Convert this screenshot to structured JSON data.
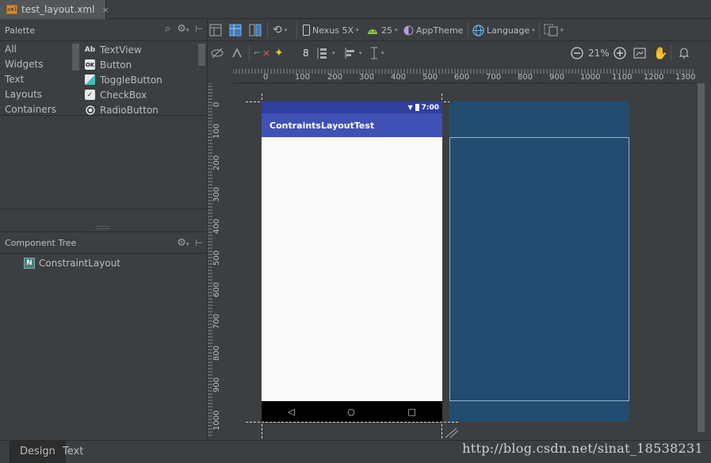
{
  "file_tab": {
    "name": "test_layout.xml",
    "close": "×",
    "icon_label": "xml"
  },
  "palette": {
    "title": "Palette",
    "categories": [
      "All",
      "Widgets",
      "Text",
      "Layouts",
      "Containers"
    ],
    "items": [
      {
        "label": "TextView",
        "icon": "textview-icon",
        "glyph": "Ab"
      },
      {
        "label": "Button",
        "icon": "button-icon",
        "glyph": "OK"
      },
      {
        "label": "ToggleButton",
        "icon": "togglebutton-icon",
        "glyph": ""
      },
      {
        "label": "CheckBox",
        "icon": "checkbox-icon",
        "glyph": "✓"
      },
      {
        "label": "RadioButton",
        "icon": "radiobutton-icon",
        "glyph": ""
      }
    ]
  },
  "component_tree": {
    "title": "Component Tree",
    "root": "ConstraintLayout",
    "root_glyph": "N"
  },
  "toolbar": {
    "device": "Nexus 5X",
    "api": "25",
    "theme": "AppTheme",
    "language": "Language",
    "zoom": "21%",
    "margin": "8"
  },
  "ruler": {
    "top": [
      "0",
      "100",
      "200",
      "300",
      "400",
      "500",
      "600",
      "700",
      "800",
      "900",
      "1000",
      "1100",
      "1200",
      "1300"
    ],
    "left": [
      "0",
      "100",
      "200",
      "300",
      "400",
      "500",
      "600",
      "700",
      "800",
      "900",
      "1000"
    ]
  },
  "device": {
    "time": "7:00",
    "app_title": "ContraintsLayoutTest",
    "nav": [
      "◁",
      "○",
      "□"
    ]
  },
  "bottom_tabs": {
    "design": "Design",
    "text": "Text"
  },
  "watermark": "http://blog.csdn.net/sinat_18538231",
  "colors": {
    "status_bar": "#303f9f",
    "app_bar": "#3f51b5",
    "blueprint": "#224d70",
    "ide_bg": "#3c3f41"
  }
}
